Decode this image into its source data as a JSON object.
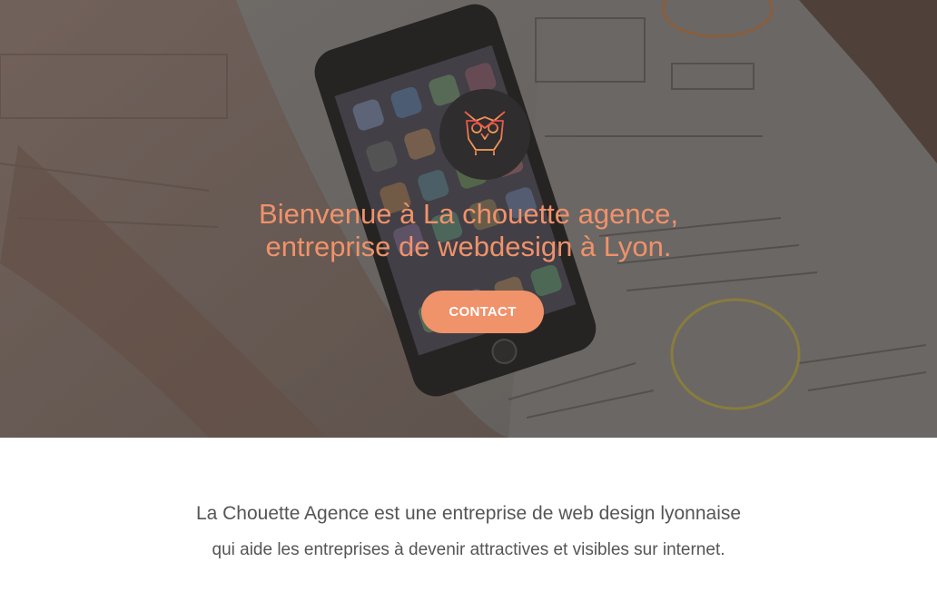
{
  "hero": {
    "headline_line1": "Bienvenue à La chouette agence,",
    "headline_line2": "entreprise de webdesign à Lyon.",
    "contact_label": "CONTACT",
    "logo_icon": "owl-icon",
    "background_image": "phone-on-sketches-photo"
  },
  "intro": {
    "line1": "La Chouette Agence est une entreprise de web design lyonnaise",
    "line2": "qui aide les entreprises à devenir attractives et visibles sur internet."
  },
  "colors": {
    "accent": "#f0926a",
    "logo_bg": "#2f2d2d",
    "body_text": "#555555",
    "hero_overlay": "#5e5854"
  }
}
